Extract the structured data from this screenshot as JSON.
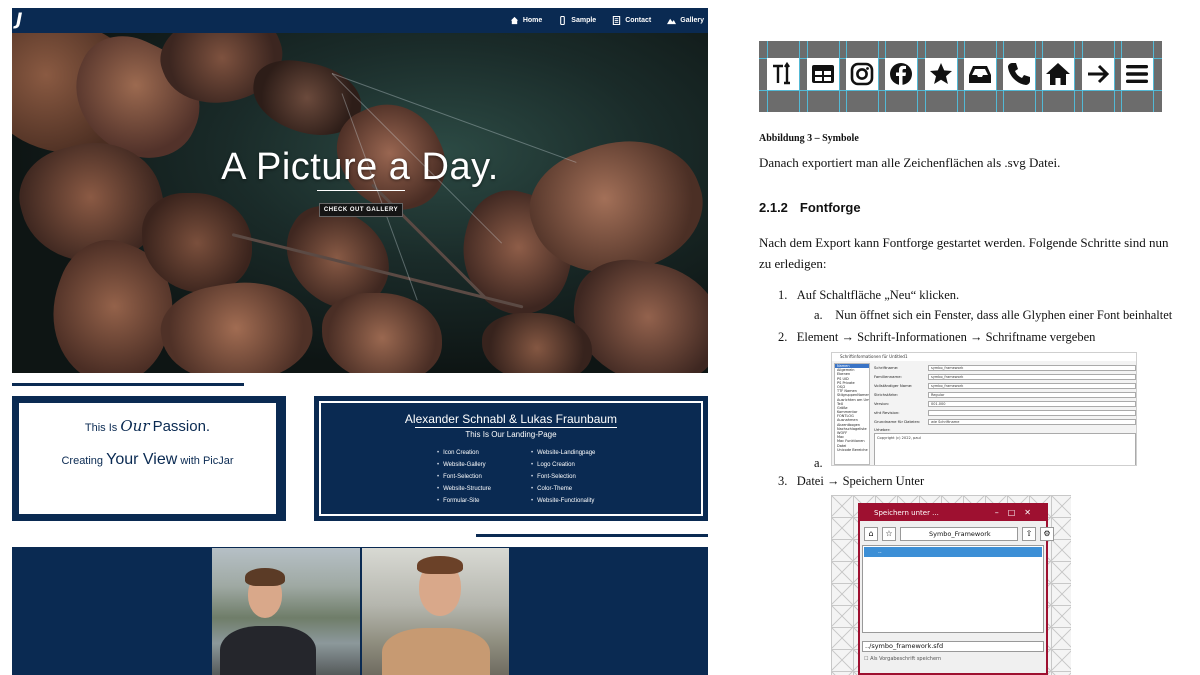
{
  "website": {
    "logo": "J",
    "nav": [
      {
        "label": "Home",
        "icon": "home-icon"
      },
      {
        "label": "Sample",
        "icon": "phone-icon"
      },
      {
        "label": "Contact",
        "icon": "contact-icon"
      },
      {
        "label": "Gallery",
        "icon": "mountain-icon"
      }
    ],
    "hero": {
      "title": "A Picture a Day.",
      "button": "CHECK OUT GALLERY"
    },
    "passion": {
      "line1_pre": "This Is",
      "line1_script": "Our",
      "line1_post": "Passion.",
      "line2_pre": "Creating",
      "line2_big": "Your View",
      "line2_post": "with PicJar"
    },
    "authors": {
      "title": "Alexander Schnabl & Lukas Fraunbaum",
      "subtitle": "This Is Our Landing-Page",
      "col1": [
        "Icon Creation",
        "Website-Gallery",
        "Font-Selection",
        "Website-Structure",
        "Formular-Site"
      ],
      "col2": [
        "Website-Landingpage",
        "Logo Creation",
        "Font-Selection",
        "Color-Theme",
        "Website-Functionality"
      ]
    },
    "colors": {
      "navy": "#0a2a52"
    }
  },
  "document": {
    "symbols": [
      "text-cursor-icon",
      "table-icon",
      "instagram-icon",
      "facebook-icon",
      "star-icon",
      "inbox-icon",
      "phone-icon",
      "home-icon",
      "arrow-right-icon",
      "menu-icon"
    ],
    "caption": "Abbildung 3 – Symbole",
    "para1": "Danach exportiert man alle Zeichenflächen als .svg Datei.",
    "heading_num": "2.1.2",
    "heading": "Fontforge",
    "para2": "Nach dem Export kann Fontforge gestartet werden. Folgende Schritte sind nun zu erledigen:",
    "steps": [
      {
        "num": "1.",
        "text": "Auf Schaltfläche „Neu“ klicken."
      },
      {
        "num": "a.",
        "text": "Nun öffnet sich ein Fenster, dass alle Glyphen einer Font beinhaltet"
      },
      {
        "num": "2.",
        "text": "Element → Schrift-Informationen → Schriftname vergeben"
      },
      {
        "num": "a.",
        "text": ""
      },
      {
        "num": "3.",
        "text": "Datei → Speichern Unter"
      }
    ],
    "fontinfo_dialog": {
      "title": "Schriftinformationen für Untitled1",
      "sidebar": [
        "Namen",
        "Allgemein",
        "Ebenen",
        "PS UID",
        "PS Private",
        "OS/2",
        "TTF Namen",
        "StilgruppenNamen",
        "Ausrichten am Umriss",
        "TeX",
        "Größe",
        "Kommentar",
        "FONTLOG",
        "Ausnahmen",
        "Akzentbogen",
        "Nachschlageliste",
        "WOFF",
        "Mac",
        "Mac Funktionen",
        "Datei",
        "Unicode Bereiche"
      ],
      "fields": [
        {
          "label": "Schriftname:",
          "value": "symbo_framework"
        },
        {
          "label": "Familienname:",
          "value": "symbo_framework"
        },
        {
          "label": "Vollständiger Name:",
          "value": "symbo_framework"
        },
        {
          "label": "Strichstärke:",
          "value": "Regular"
        },
        {
          "label": "Version:",
          "value": "001.000"
        },
        {
          "label": "sfnt Revision:",
          "value": ""
        },
        {
          "label": "Grundname für Dateien:",
          "value": "wie Schriftname"
        }
      ],
      "copyright_label": "Urheber:",
      "copyright": "Copyright (c) 2022, paul"
    },
    "save_dialog": {
      "title": "Speichern unter ...",
      "folder": "Symbo_Framework",
      "list_item": "..",
      "filename": "../symbo_framework.sfd",
      "checkbox": "Als Vorgabeschrift speichern"
    }
  }
}
